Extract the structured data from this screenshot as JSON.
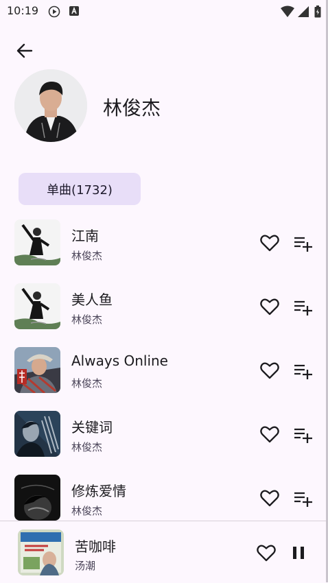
{
  "status_bar": {
    "time": "10:19"
  },
  "artist": {
    "name": "林俊杰"
  },
  "filter_chip": {
    "label": "单曲(1732)"
  },
  "songs": [
    {
      "title": "江南",
      "artist": "林俊杰"
    },
    {
      "title": "美人鱼",
      "artist": "林俊杰"
    },
    {
      "title": "Always Online",
      "artist": "林俊杰"
    },
    {
      "title": "关键词",
      "artist": "林俊杰"
    },
    {
      "title": "修炼爱情",
      "artist": "林俊杰"
    }
  ],
  "now_playing": {
    "title": "苦咖啡",
    "artist": "汤潮"
  },
  "colors": {
    "background": "#fdf7fe",
    "chip": "#e8def8",
    "text": "#1c1b1f",
    "subtext": "#4a4458"
  }
}
